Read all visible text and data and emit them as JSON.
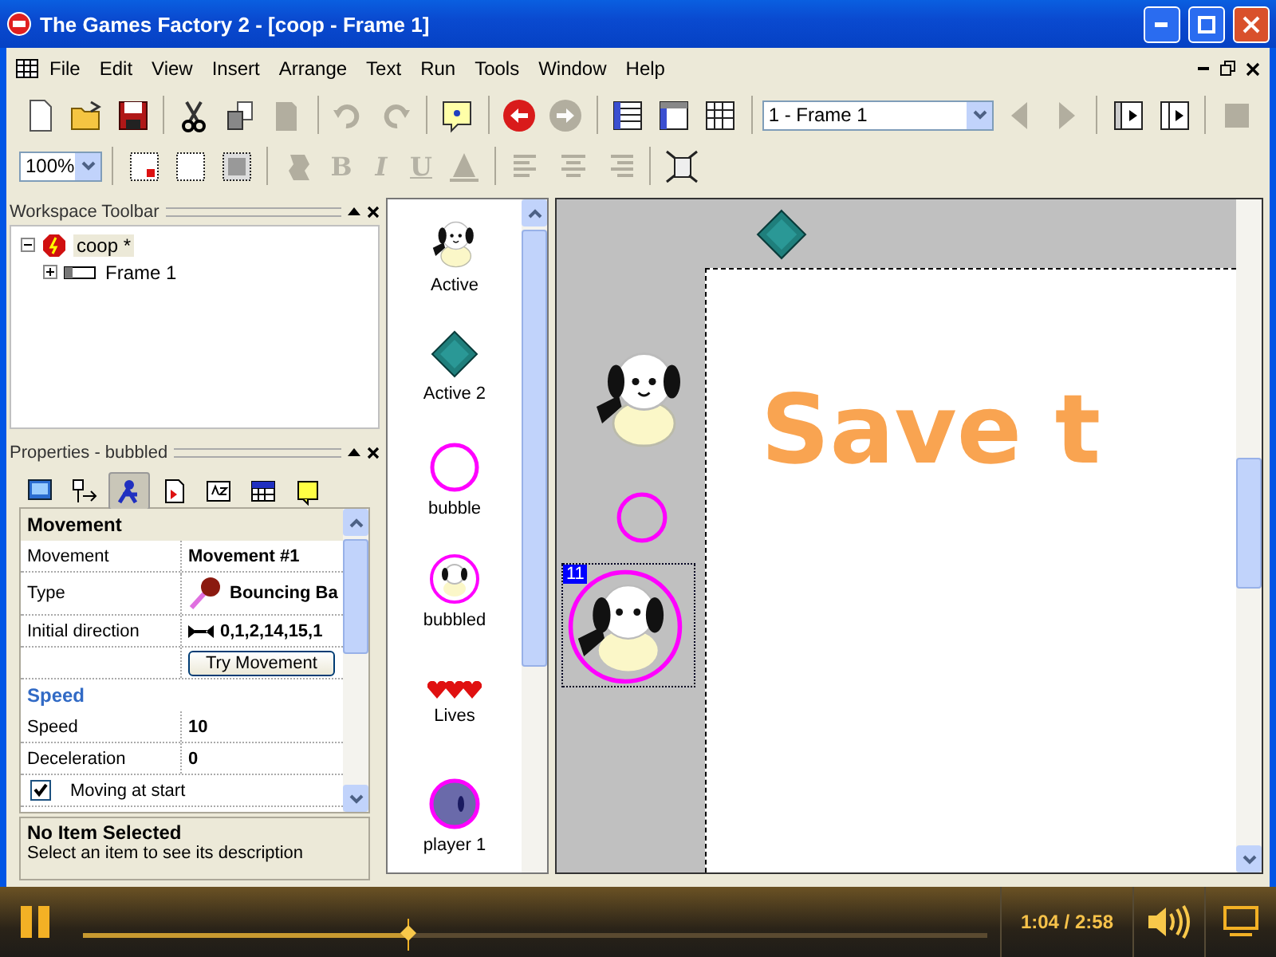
{
  "window": {
    "title": "The Games Factory 2 - [coop - Frame 1]"
  },
  "menu": [
    {
      "label": "File"
    },
    {
      "label": "Edit"
    },
    {
      "label": "View"
    },
    {
      "label": "Insert"
    },
    {
      "label": "Arrange"
    },
    {
      "label": "Text"
    },
    {
      "label": "Run"
    },
    {
      "label": "Tools"
    },
    {
      "label": "Window"
    },
    {
      "label": "Help"
    }
  ],
  "toolbar": {
    "row1": [
      {
        "kind": "new",
        "disabled": false
      },
      {
        "kind": "open",
        "disabled": false
      },
      {
        "kind": "save",
        "disabled": false
      },
      {
        "kind": "sep"
      },
      {
        "kind": "cut",
        "disabled": false
      },
      {
        "kind": "copy",
        "disabled": false
      },
      {
        "kind": "paste",
        "disabled": true
      },
      {
        "kind": "sep"
      },
      {
        "kind": "undo",
        "disabled": true
      },
      {
        "kind": "redo",
        "disabled": true
      },
      {
        "kind": "sep"
      },
      {
        "kind": "help",
        "disabled": false
      },
      {
        "kind": "sep"
      },
      {
        "kind": "back",
        "disabled": false
      },
      {
        "kind": "forward",
        "disabled": true
      },
      {
        "kind": "sep"
      },
      {
        "kind": "list",
        "disabled": false
      },
      {
        "kind": "panel",
        "disabled": false
      },
      {
        "kind": "grid",
        "disabled": false
      },
      {
        "kind": "sep"
      },
      {
        "kind": "frame_select",
        "value": "1 - Frame 1"
      },
      {
        "kind": "prev",
        "disabled": true
      },
      {
        "kind": "next",
        "disabled": true
      },
      {
        "kind": "sep"
      },
      {
        "kind": "run_frame",
        "disabled": false
      },
      {
        "kind": "run_app",
        "disabled": false
      },
      {
        "kind": "sep"
      },
      {
        "kind": "stop",
        "disabled": true
      }
    ],
    "row2": [
      {
        "kind": "zoom_select",
        "value": "100%"
      },
      {
        "kind": "sep"
      },
      {
        "kind": "grid_setup",
        "disabled": false
      },
      {
        "kind": "grid_show",
        "disabled": false
      },
      {
        "kind": "grid_snap",
        "disabled": false
      },
      {
        "kind": "sep"
      },
      {
        "kind": "effect",
        "disabled": true
      },
      {
        "kind": "format",
        "label": "B",
        "disabled": true
      },
      {
        "kind": "format",
        "label": "I",
        "disabled": true
      },
      {
        "kind": "format",
        "label": "U",
        "disabled": true
      },
      {
        "kind": "color",
        "disabled": true
      },
      {
        "kind": "sep"
      },
      {
        "kind": "align_left",
        "disabled": true
      },
      {
        "kind": "align_center",
        "disabled": true
      },
      {
        "kind": "align_right",
        "disabled": true
      },
      {
        "kind": "sep"
      },
      {
        "kind": "fit",
        "disabled": false
      }
    ]
  },
  "workspace": {
    "title": "Workspace Toolbar",
    "tree": [
      {
        "label": "coop *",
        "expanded": true,
        "selected": true,
        "children": [
          {
            "label": "Frame 1",
            "expanded": false,
            "selected": false
          }
        ]
      }
    ]
  },
  "properties": {
    "title": "Properties - bubbled",
    "tabs": [
      {
        "selected": false
      },
      {
        "selected": false
      },
      {
        "selected": true
      },
      {
        "selected": false
      },
      {
        "selected": false
      },
      {
        "selected": false
      },
      {
        "selected": false
      }
    ],
    "rows": [
      {
        "kind": "section",
        "label": "Movement"
      },
      {
        "kind": "value",
        "label": "Movement",
        "value": "Movement #1"
      },
      {
        "kind": "type",
        "label": "Type",
        "value": "Bouncing Ba"
      },
      {
        "kind": "direction",
        "label": "Initial direction",
        "value": "0,1,2,14,15,1"
      },
      {
        "kind": "button",
        "value": "Try Movement"
      },
      {
        "kind": "section",
        "label": "Speed"
      },
      {
        "kind": "value",
        "label": "Speed",
        "value": "10"
      },
      {
        "kind": "value",
        "label": "Deceleration",
        "value": "0"
      },
      {
        "kind": "check",
        "label": "Moving at start",
        "checked": true
      }
    ],
    "description": {
      "title": "No Item Selected",
      "text": "Select an item to see its description"
    }
  },
  "objects": [
    {
      "kind": "dog",
      "label": "Active"
    },
    {
      "kind": "diamond",
      "label": "Active 2"
    },
    {
      "kind": "ring",
      "label": "bubble"
    },
    {
      "kind": "bubbled",
      "label": "bubbled"
    },
    {
      "kind": "hearts",
      "label": "Lives"
    },
    {
      "kind": "ship",
      "label": "player 1"
    }
  ],
  "frame": {
    "text": "Save t",
    "selected_tag": "11"
  },
  "player": {
    "time": "1:04 / 2:58",
    "level": 0.36
  }
}
